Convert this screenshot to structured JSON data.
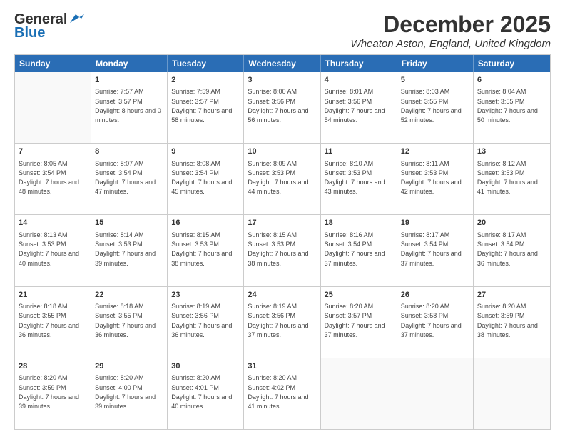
{
  "logo": {
    "line1": "General",
    "line2": "Blue"
  },
  "title": "December 2025",
  "location": "Wheaton Aston, England, United Kingdom",
  "days_of_week": [
    "Sunday",
    "Monday",
    "Tuesday",
    "Wednesday",
    "Thursday",
    "Friday",
    "Saturday"
  ],
  "weeks": [
    [
      {
        "day": "",
        "empty": true
      },
      {
        "day": "1",
        "sunrise": "7:57 AM",
        "sunset": "3:57 PM",
        "daylight": "8 hours and 0 minutes."
      },
      {
        "day": "2",
        "sunrise": "7:59 AM",
        "sunset": "3:57 PM",
        "daylight": "7 hours and 58 minutes."
      },
      {
        "day": "3",
        "sunrise": "8:00 AM",
        "sunset": "3:56 PM",
        "daylight": "7 hours and 56 minutes."
      },
      {
        "day": "4",
        "sunrise": "8:01 AM",
        "sunset": "3:56 PM",
        "daylight": "7 hours and 54 minutes."
      },
      {
        "day": "5",
        "sunrise": "8:03 AM",
        "sunset": "3:55 PM",
        "daylight": "7 hours and 52 minutes."
      },
      {
        "day": "6",
        "sunrise": "8:04 AM",
        "sunset": "3:55 PM",
        "daylight": "7 hours and 50 minutes."
      }
    ],
    [
      {
        "day": "7",
        "sunrise": "8:05 AM",
        "sunset": "3:54 PM",
        "daylight": "7 hours and 48 minutes."
      },
      {
        "day": "8",
        "sunrise": "8:07 AM",
        "sunset": "3:54 PM",
        "daylight": "7 hours and 47 minutes."
      },
      {
        "day": "9",
        "sunrise": "8:08 AM",
        "sunset": "3:54 PM",
        "daylight": "7 hours and 45 minutes."
      },
      {
        "day": "10",
        "sunrise": "8:09 AM",
        "sunset": "3:53 PM",
        "daylight": "7 hours and 44 minutes."
      },
      {
        "day": "11",
        "sunrise": "8:10 AM",
        "sunset": "3:53 PM",
        "daylight": "7 hours and 43 minutes."
      },
      {
        "day": "12",
        "sunrise": "8:11 AM",
        "sunset": "3:53 PM",
        "daylight": "7 hours and 42 minutes."
      },
      {
        "day": "13",
        "sunrise": "8:12 AM",
        "sunset": "3:53 PM",
        "daylight": "7 hours and 41 minutes."
      }
    ],
    [
      {
        "day": "14",
        "sunrise": "8:13 AM",
        "sunset": "3:53 PM",
        "daylight": "7 hours and 40 minutes."
      },
      {
        "day": "15",
        "sunrise": "8:14 AM",
        "sunset": "3:53 PM",
        "daylight": "7 hours and 39 minutes."
      },
      {
        "day": "16",
        "sunrise": "8:15 AM",
        "sunset": "3:53 PM",
        "daylight": "7 hours and 38 minutes."
      },
      {
        "day": "17",
        "sunrise": "8:15 AM",
        "sunset": "3:53 PM",
        "daylight": "7 hours and 38 minutes."
      },
      {
        "day": "18",
        "sunrise": "8:16 AM",
        "sunset": "3:54 PM",
        "daylight": "7 hours and 37 minutes."
      },
      {
        "day": "19",
        "sunrise": "8:17 AM",
        "sunset": "3:54 PM",
        "daylight": "7 hours and 37 minutes."
      },
      {
        "day": "20",
        "sunrise": "8:17 AM",
        "sunset": "3:54 PM",
        "daylight": "7 hours and 36 minutes."
      }
    ],
    [
      {
        "day": "21",
        "sunrise": "8:18 AM",
        "sunset": "3:55 PM",
        "daylight": "7 hours and 36 minutes."
      },
      {
        "day": "22",
        "sunrise": "8:18 AM",
        "sunset": "3:55 PM",
        "daylight": "7 hours and 36 minutes."
      },
      {
        "day": "23",
        "sunrise": "8:19 AM",
        "sunset": "3:56 PM",
        "daylight": "7 hours and 36 minutes."
      },
      {
        "day": "24",
        "sunrise": "8:19 AM",
        "sunset": "3:56 PM",
        "daylight": "7 hours and 37 minutes."
      },
      {
        "day": "25",
        "sunrise": "8:20 AM",
        "sunset": "3:57 PM",
        "daylight": "7 hours and 37 minutes."
      },
      {
        "day": "26",
        "sunrise": "8:20 AM",
        "sunset": "3:58 PM",
        "daylight": "7 hours and 37 minutes."
      },
      {
        "day": "27",
        "sunrise": "8:20 AM",
        "sunset": "3:59 PM",
        "daylight": "7 hours and 38 minutes."
      }
    ],
    [
      {
        "day": "28",
        "sunrise": "8:20 AM",
        "sunset": "3:59 PM",
        "daylight": "7 hours and 39 minutes."
      },
      {
        "day": "29",
        "sunrise": "8:20 AM",
        "sunset": "4:00 PM",
        "daylight": "7 hours and 39 minutes."
      },
      {
        "day": "30",
        "sunrise": "8:20 AM",
        "sunset": "4:01 PM",
        "daylight": "7 hours and 40 minutes."
      },
      {
        "day": "31",
        "sunrise": "8:20 AM",
        "sunset": "4:02 PM",
        "daylight": "7 hours and 41 minutes."
      },
      {
        "day": "",
        "empty": true
      },
      {
        "day": "",
        "empty": true
      },
      {
        "day": "",
        "empty": true
      }
    ]
  ]
}
